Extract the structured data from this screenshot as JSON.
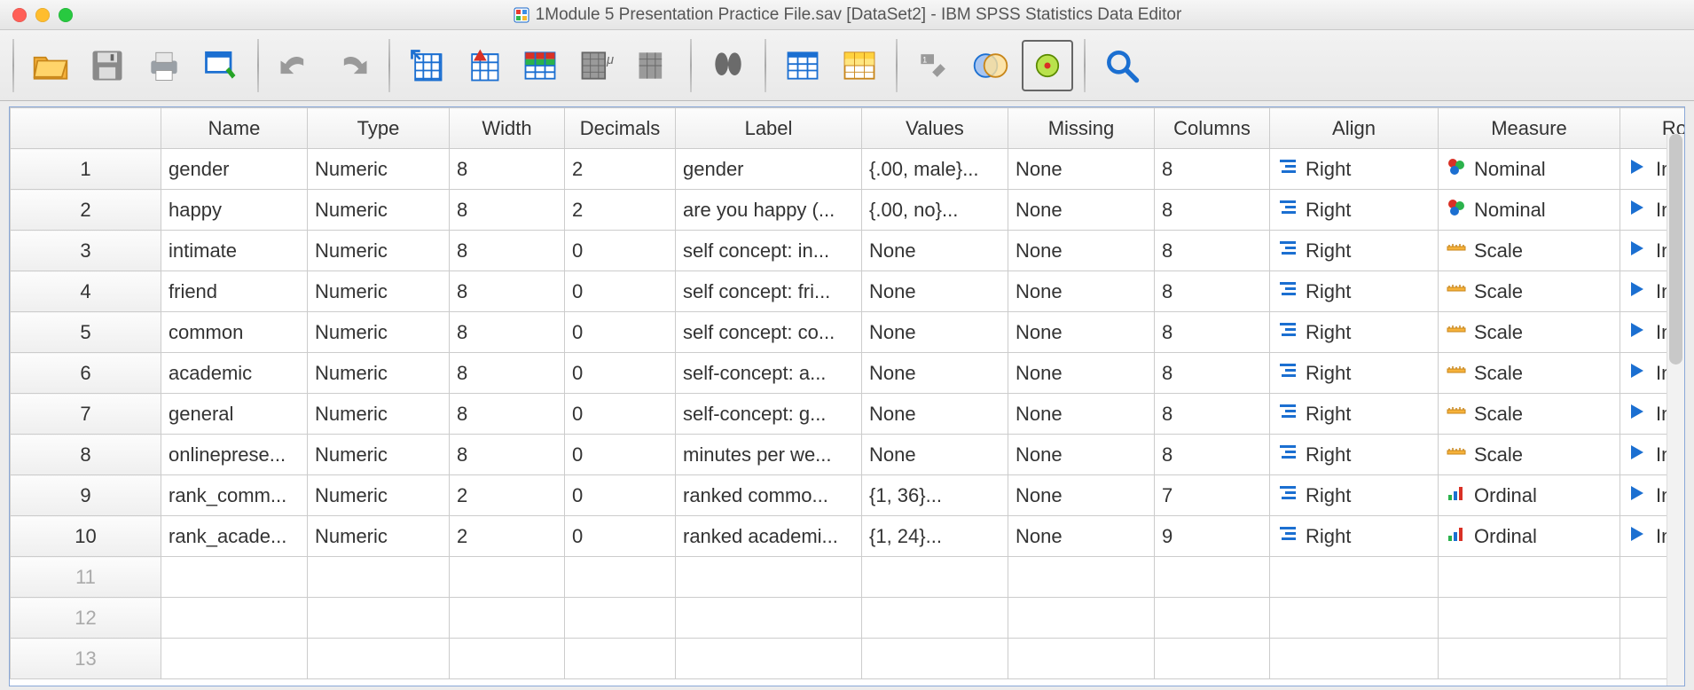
{
  "window": {
    "title": "1Module 5 Presentation Practice File.sav [DataSet2] - IBM SPSS Statistics Data Editor"
  },
  "toolbar_icons": [
    "open-file-icon",
    "save-icon",
    "print-icon",
    "recall-dialog-icon",
    "undo-icon",
    "redo-icon",
    "goto-case-icon",
    "goto-variable-icon",
    "variables-icon",
    "run-syntax-icon",
    "descriptives-icon",
    "find-icon",
    "split-file-icon",
    "weight-cases-icon",
    "select-cases-icon",
    "value-labels-icon",
    "use-variable-sets-icon",
    "zoom-icon"
  ],
  "columns": {
    "name": "Name",
    "type": "Type",
    "width": "Width",
    "decimals": "Decimals",
    "label": "Label",
    "values": "Values",
    "missing": "Missing",
    "columns_col": "Columns",
    "align": "Align",
    "measure": "Measure",
    "role": "Role"
  },
  "rows": [
    {
      "n": "1",
      "name": "gender",
      "type": "Numeric",
      "width": "8",
      "decimals": "2",
      "label": "gender",
      "values": "{.00, male}...",
      "missing": "None",
      "columns": "8",
      "align": "Right",
      "measure": "Nominal",
      "role": "Input"
    },
    {
      "n": "2",
      "name": "happy",
      "type": "Numeric",
      "width": "8",
      "decimals": "2",
      "label": "are you happy (...",
      "values": "{.00, no}...",
      "missing": "None",
      "columns": "8",
      "align": "Right",
      "measure": "Nominal",
      "role": "Input"
    },
    {
      "n": "3",
      "name": "intimate",
      "type": "Numeric",
      "width": "8",
      "decimals": "0",
      "label": "self concept: in...",
      "values": "None",
      "missing": "None",
      "columns": "8",
      "align": "Right",
      "measure": "Scale",
      "role": "Input"
    },
    {
      "n": "4",
      "name": "friend",
      "type": "Numeric",
      "width": "8",
      "decimals": "0",
      "label": "self concept: fri...",
      "values": "None",
      "missing": "None",
      "columns": "8",
      "align": "Right",
      "measure": "Scale",
      "role": "Input"
    },
    {
      "n": "5",
      "name": "common",
      "type": "Numeric",
      "width": "8",
      "decimals": "0",
      "label": "self concept: co...",
      "values": "None",
      "missing": "None",
      "columns": "8",
      "align": "Right",
      "measure": "Scale",
      "role": "Input"
    },
    {
      "n": "6",
      "name": "academic",
      "type": "Numeric",
      "width": "8",
      "decimals": "0",
      "label": "self-concept: a...",
      "values": "None",
      "missing": "None",
      "columns": "8",
      "align": "Right",
      "measure": "Scale",
      "role": "Input"
    },
    {
      "n": "7",
      "name": "general",
      "type": "Numeric",
      "width": "8",
      "decimals": "0",
      "label": "self-concept: g...",
      "values": "None",
      "missing": "None",
      "columns": "8",
      "align": "Right",
      "measure": "Scale",
      "role": "Input"
    },
    {
      "n": "8",
      "name": "onlineprese...",
      "type": "Numeric",
      "width": "8",
      "decimals": "0",
      "label": "minutes per we...",
      "values": "None",
      "missing": "None",
      "columns": "8",
      "align": "Right",
      "measure": "Scale",
      "role": "Input"
    },
    {
      "n": "9",
      "name": "rank_comm...",
      "type": "Numeric",
      "width": "2",
      "decimals": "0",
      "label": "ranked commo...",
      "values": "{1, 36}...",
      "missing": "None",
      "columns": "7",
      "align": "Right",
      "measure": "Ordinal",
      "role": "Input"
    },
    {
      "n": "10",
      "name": "rank_acade...",
      "type": "Numeric",
      "width": "2",
      "decimals": "0",
      "label": "ranked academi...",
      "values": "{1, 24}...",
      "missing": "None",
      "columns": "9",
      "align": "Right",
      "measure": "Ordinal",
      "role": "Input"
    }
  ],
  "empty_rows": [
    "11",
    "12",
    "13"
  ]
}
